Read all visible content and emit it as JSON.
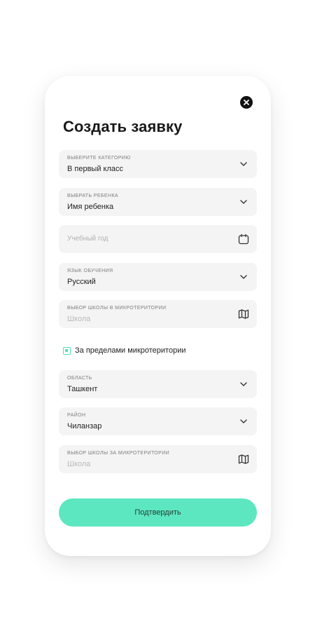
{
  "form": {
    "title": "Создать заявку",
    "fields": [
      {
        "label": "Выберите категорию",
        "value": "В первый класс",
        "icon": "chevron-down-icon"
      },
      {
        "label": "Выбрать ребенка",
        "value": "Имя ребенка",
        "icon": "chevron-down-icon"
      },
      {
        "placeholder": "Учебный год",
        "icon": "calendar-icon"
      },
      {
        "label": "Язык обучения",
        "value": "Русский",
        "icon": "chevron-down-icon"
      },
      {
        "label": "Выбор школы в микротеритории",
        "placeholder": "Школа",
        "icon": "map-icon"
      },
      {
        "label": "Область",
        "value": "Ташкент",
        "icon": "chevron-down-icon"
      },
      {
        "label": "Район",
        "value": "Чиланзар",
        "icon": "chevron-down-icon"
      },
      {
        "label": "Выбор школы за микротеритории",
        "placeholder": "Школа",
        "icon": "map-icon"
      }
    ],
    "checkbox": {
      "label": "За пределами микротеритории",
      "checked": true
    },
    "submit_label": "Подтвердить"
  },
  "colors": {
    "accent": "#5de7c0",
    "field_bg": "#f4f4f4",
    "close_bg": "#111111"
  }
}
